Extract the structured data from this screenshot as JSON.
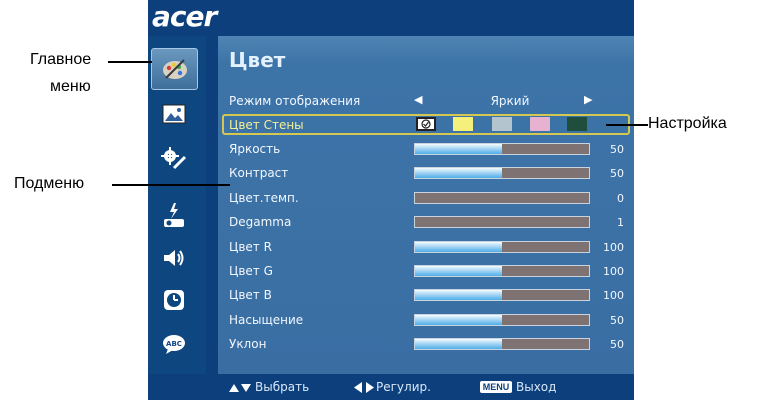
{
  "brand": "acer",
  "menu": {
    "title": "Цвет",
    "sidebar_icons": [
      "color-palette-icon",
      "image-icon",
      "settings-icon",
      "projector-icon",
      "speaker-icon",
      "clock-icon",
      "language-icon"
    ],
    "display_mode": {
      "label": "Режим отображения",
      "value": "Яркий"
    },
    "wall_color": {
      "label": "Цвет Стены",
      "swatches": [
        "#f5f07c",
        "#b4c4cf",
        "#e6b2cf",
        "#1f4e3d"
      ]
    },
    "rows": [
      {
        "label": "Яркость",
        "value": "50",
        "fill": 0.5
      },
      {
        "label": "Контраст",
        "value": "50",
        "fill": 0.5
      },
      {
        "label": "Цвет.темп.",
        "value": "0",
        "fill": 0
      },
      {
        "label": "Degamma",
        "value": "1",
        "fill": 0
      },
      {
        "label": "Цвет R",
        "value": "100",
        "fill": 0.5
      },
      {
        "label": "Цвет G",
        "value": "100",
        "fill": 0.5
      },
      {
        "label": "Цвет B",
        "value": "100",
        "fill": 0.5
      },
      {
        "label": "Насыщение",
        "value": "50",
        "fill": 0.5
      },
      {
        "label": "Уклон",
        "value": "50",
        "fill": 0.5
      }
    ]
  },
  "footer": {
    "select": "Выбрать",
    "adjust": "Регулир.",
    "menu_key": "MENU",
    "exit": "Выход"
  },
  "callouts": {
    "main_menu_line1": "Главное",
    "main_menu_line2": "меню",
    "submenu": "Подменю",
    "setting": "Настройка"
  },
  "colors": {
    "osd_background": "#0d3f7c",
    "panel": "#3a6ea3",
    "highlight_border": "#d4c852",
    "bar_fill": "#4eaee8",
    "bar_track": "#7f7272"
  }
}
